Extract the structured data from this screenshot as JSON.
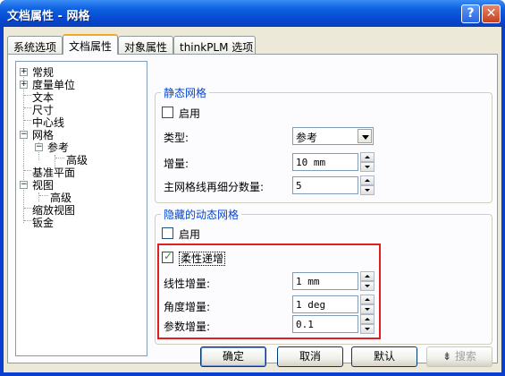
{
  "window": {
    "title": "文档属性 - 网格",
    "help": "?",
    "close": "✕"
  },
  "tabs": [
    "系统选项",
    "文档属性",
    "对象属性",
    "thinkPLM 选项"
  ],
  "tree": {
    "items": [
      "常规",
      "度量单位",
      "文本",
      "尺寸",
      "中心线",
      "网格",
      "参考",
      "高级",
      "基准平面",
      "视图",
      "高级",
      "缩放视图",
      "钣金"
    ],
    "expanders": [
      "+",
      "+",
      "−",
      "−",
      "−"
    ]
  },
  "static_grid": {
    "title": "静态网格",
    "enable_label": "启用",
    "enabled": false,
    "type_label": "类型:",
    "type_value": "参考",
    "increment_label": "增量:",
    "increment_value": "10 mm",
    "subdiv_label": "主网格线再细分数量:",
    "subdiv_value": "5"
  },
  "dynamic_grid": {
    "title": "隐藏的动态网格",
    "enable_label": "启用",
    "enabled": false,
    "flex_label": "柔性递增",
    "flex_checked": true,
    "linear_label": "线性增量:",
    "linear_value": "1 mm",
    "angle_label": "角度增量:",
    "angle_value": "1 deg",
    "param_label": "参数增量:",
    "param_value": "0.1"
  },
  "buttons": {
    "ok": "确定",
    "cancel": "取消",
    "default": "默认",
    "search": "搜索",
    "search_icon": "⇟"
  }
}
